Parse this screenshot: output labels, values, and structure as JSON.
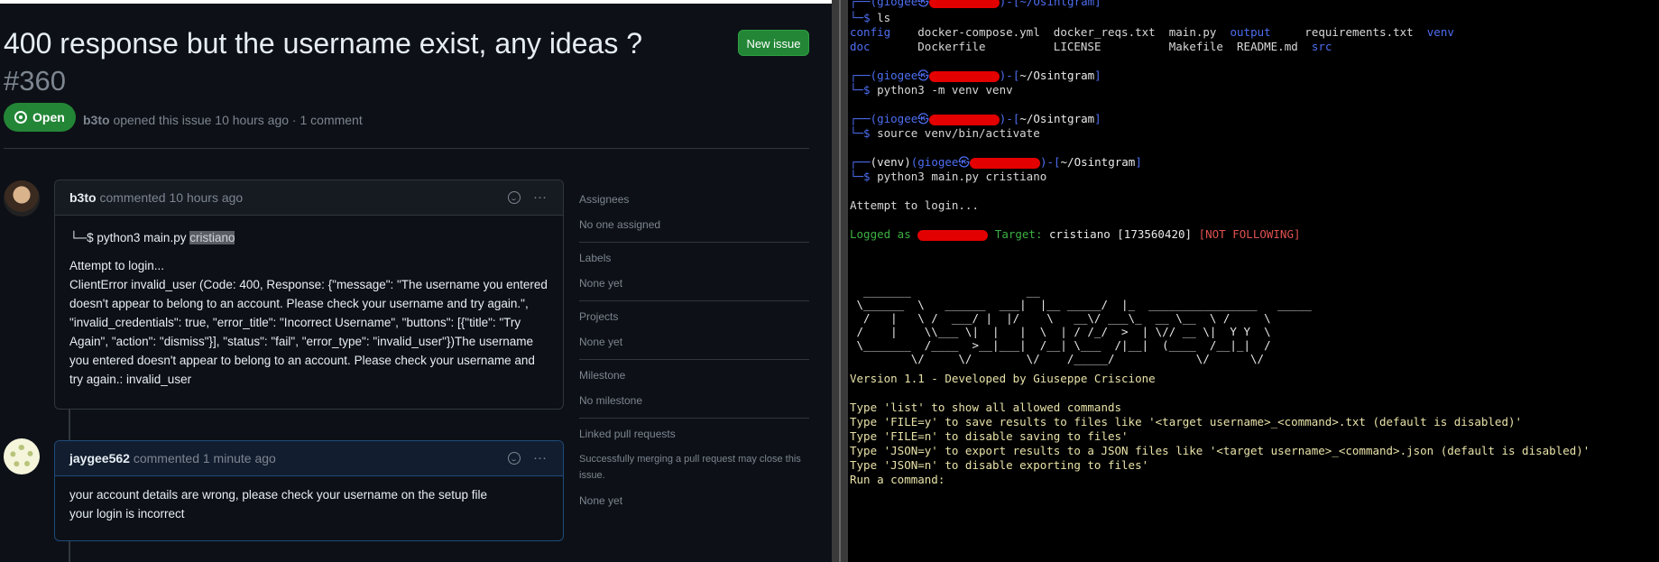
{
  "issue": {
    "title": "400 response but the username exist, any ideas ?",
    "number": "#360",
    "new_issue_label": "New issue",
    "state": "Open",
    "author": "b3to",
    "meta_suffix": "opened this issue 10 hours ago · 1 comment"
  },
  "comments": [
    {
      "author": "b3to",
      "time": "commented 10 hours ago",
      "cmd_prefix": "└─$ python3 main.py ",
      "cmd_arg": "cristiano",
      "line1": "Attempt to login...",
      "line2": "ClientError invalid_user (Code: 400, Response: {\"message\": \"The username you entered doesn't appear to belong to an account. Please check your username and try again.\", \"invalid_credentials\": true, \"error_title\": \"Incorrect Username\", \"buttons\": [{\"title\": \"Try Again\", \"action\": \"dismiss\"}], \"status\": \"fail\", \"error_type\": \"invalid_user\"})The username you entered doesn't appear to belong to an account. Please check your username and try again.: invalid_user"
    },
    {
      "author": "jaygee562",
      "time": "commented 1 minute ago",
      "line1": "your account details are wrong, please check your username on the setup file",
      "line2": "your login is incorrect"
    }
  ],
  "sidebar": {
    "assignees_label": "Assignees",
    "assignees_value": "No one assigned",
    "labels_label": "Labels",
    "labels_value": "None yet",
    "projects_label": "Projects",
    "projects_value": "None yet",
    "milestone_label": "Milestone",
    "milestone_value": "No milestone",
    "linked_label": "Linked pull requests",
    "linked_desc": "Successfully merging a pull request may close this issue.",
    "linked_value": "None yet"
  },
  "terminal": {
    "ls_cmd": "ls",
    "ls_row1": [
      "config",
      "docker-compose.yml",
      "docker_reqs.txt",
      "main.py",
      "output",
      "requirements.txt",
      "venv"
    ],
    "ls_row2": [
      "doc",
      "Dockerfile",
      "LICENSE",
      "Makefile",
      "README.md",
      "src"
    ],
    "user": "giogee",
    "venv": "(venv)",
    "path": "~/Osintgram",
    "cmd1": "python3 -m venv venv",
    "cmd2": "source venv/bin/activate",
    "cmd3": "python3 main.py cristiano",
    "attempt": "Attempt to login...",
    "logged_as": "Logged as",
    "target_label": "Target:",
    "target_name": "cristiano",
    "target_id": "[173560420]",
    "not_following": "[NOT FOLLOWING]",
    "version": "Version 1.1 - Developed by Giuseppe Criscione",
    "help1": "Type 'list' to show all allowed commands",
    "help2": "Type 'FILE=y' to save results to files like '<target username>_<command>.txt (default is disabled)'",
    "help3": "Type 'FILE=n' to disable saving to files'",
    "help4": "Type 'JSON=y' to export results to a JSON files like '<target username>_<command>.json (default is disabled)'",
    "help5": "Type 'JSON=n' to disable exporting to files'",
    "prompt": "Run a command:"
  }
}
